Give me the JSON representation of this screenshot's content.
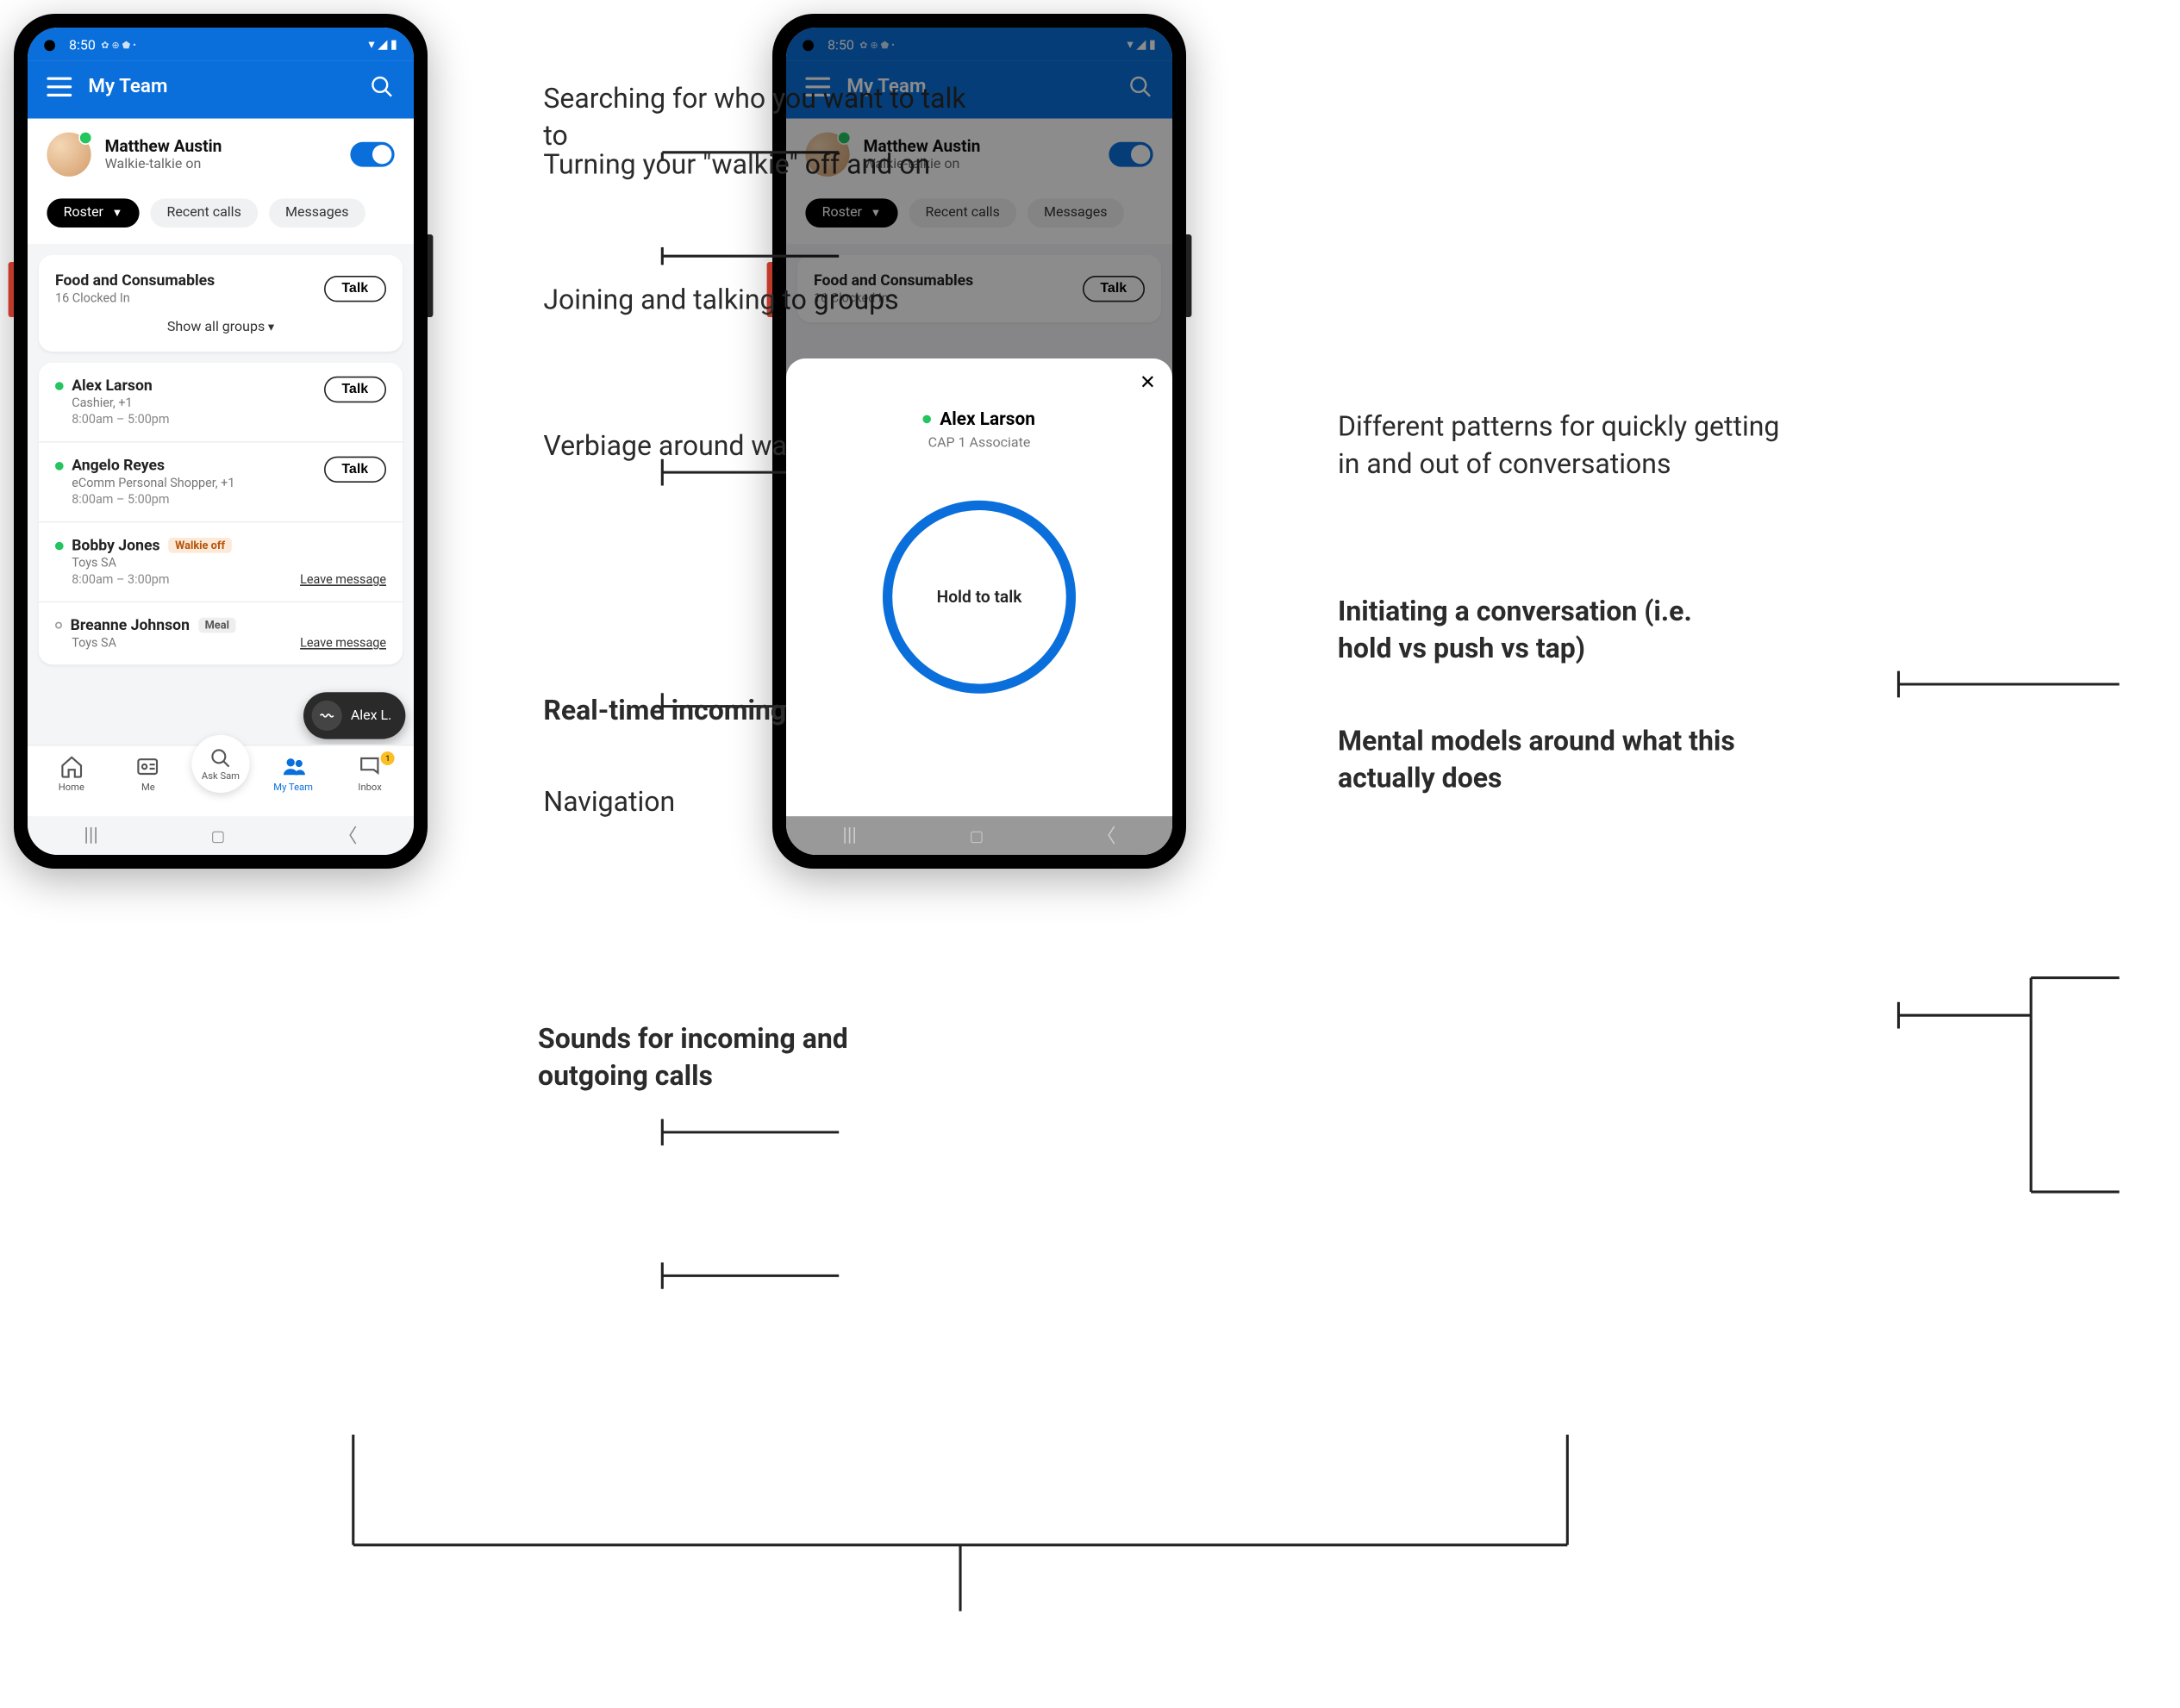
{
  "status_bar": {
    "time": "8:50",
    "indicators": "✿ ⊕ ⬟ •",
    "right_icons": "▾ ◢ ▮"
  },
  "app_bar": {
    "title": "My Team"
  },
  "user": {
    "name": "Matthew Austin",
    "subtitle": "Walkie-talkie on"
  },
  "pills": {
    "roster": "Roster",
    "recent": "Recent calls",
    "messages": "Messages"
  },
  "group": {
    "title": "Food and Consumables",
    "sub": "16 Clocked In",
    "talk": "Talk",
    "show_all": "Show all groups"
  },
  "roster": [
    {
      "name": "Alex Larson",
      "role": "Cashier, +1",
      "time": "8:00am – 5:00pm",
      "status": "green",
      "action": "Talk",
      "action_type": "button"
    },
    {
      "name": "Angelo Reyes",
      "role": "eComm Personal Shopper, +1",
      "time": "8:00am – 5:00pm",
      "status": "green",
      "action": "Talk",
      "action_type": "button"
    },
    {
      "name": "Bobby Jones",
      "role": "Toys SA",
      "time": "8:00am – 3:00pm",
      "status": "green",
      "badge": "Walkie off",
      "badge_class": "walkie-off",
      "action": "Leave message",
      "action_type": "link"
    },
    {
      "name": "Breanne Johnson",
      "role": "Toys SA",
      "time": "",
      "status": "hollow",
      "badge": "Meal",
      "badge_class": "meal",
      "action": "Leave message",
      "action_type": "link"
    }
  ],
  "incoming": {
    "label": "Alex L."
  },
  "nav": {
    "home": "Home",
    "me": "Me",
    "ask": "Ask Sam",
    "team": "My Team",
    "inbox": "Inbox",
    "inbox_badge": "1"
  },
  "sheet": {
    "name": "Alex Larson",
    "role": "CAP 1 Associate",
    "hold": "Hold to talk"
  },
  "annotations": {
    "a1": "Searching for who you want to talk to",
    "a2": "Turning your \"walkie\" off and on",
    "a3": "Joining and talking to groups",
    "a4": "Verbiage around walkie actions",
    "a5": "Real-time incoming calls",
    "a6": "Navigation",
    "a7": "Sounds for incoming and outgoing calls",
    "b1": "Different patterns for quickly getting in and out of conversations",
    "b2": "Initiating a conversation (i.e. hold vs push vs tap)",
    "b3": "Mental models around what this actually does"
  }
}
